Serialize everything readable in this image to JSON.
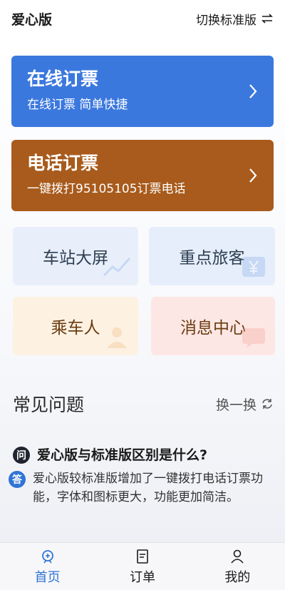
{
  "header": {
    "title": "爱心版",
    "switch_label": "切换标准版"
  },
  "cards": {
    "online": {
      "title": "在线订票",
      "subtitle": "在线订票 简单快捷",
      "color": "#3b78de"
    },
    "phone": {
      "title": "电话订票",
      "subtitle": "一键拨打95105105订票电话",
      "color": "#a85b1c"
    }
  },
  "tiles": {
    "station": "车站大屏",
    "key_passenger": "重点旅客",
    "rider": "乘车人",
    "messages": "消息中心"
  },
  "faq": {
    "title": "常见问题",
    "refresh": "换一换",
    "q_badge": "问",
    "a_badge": "答",
    "question": "爱心版与标准版区别是什么?",
    "answer": "爱心版较标准版增加了一键拨打电话订票功能，字体和图标更大，功能更加简洁。"
  },
  "nav": {
    "items": [
      {
        "label": "首页",
        "icon": "train-icon",
        "active": true
      },
      {
        "label": "订单",
        "icon": "order-icon",
        "active": false
      },
      {
        "label": "我的",
        "icon": "user-icon",
        "active": false
      }
    ],
    "active_color": "#2f74d6"
  }
}
